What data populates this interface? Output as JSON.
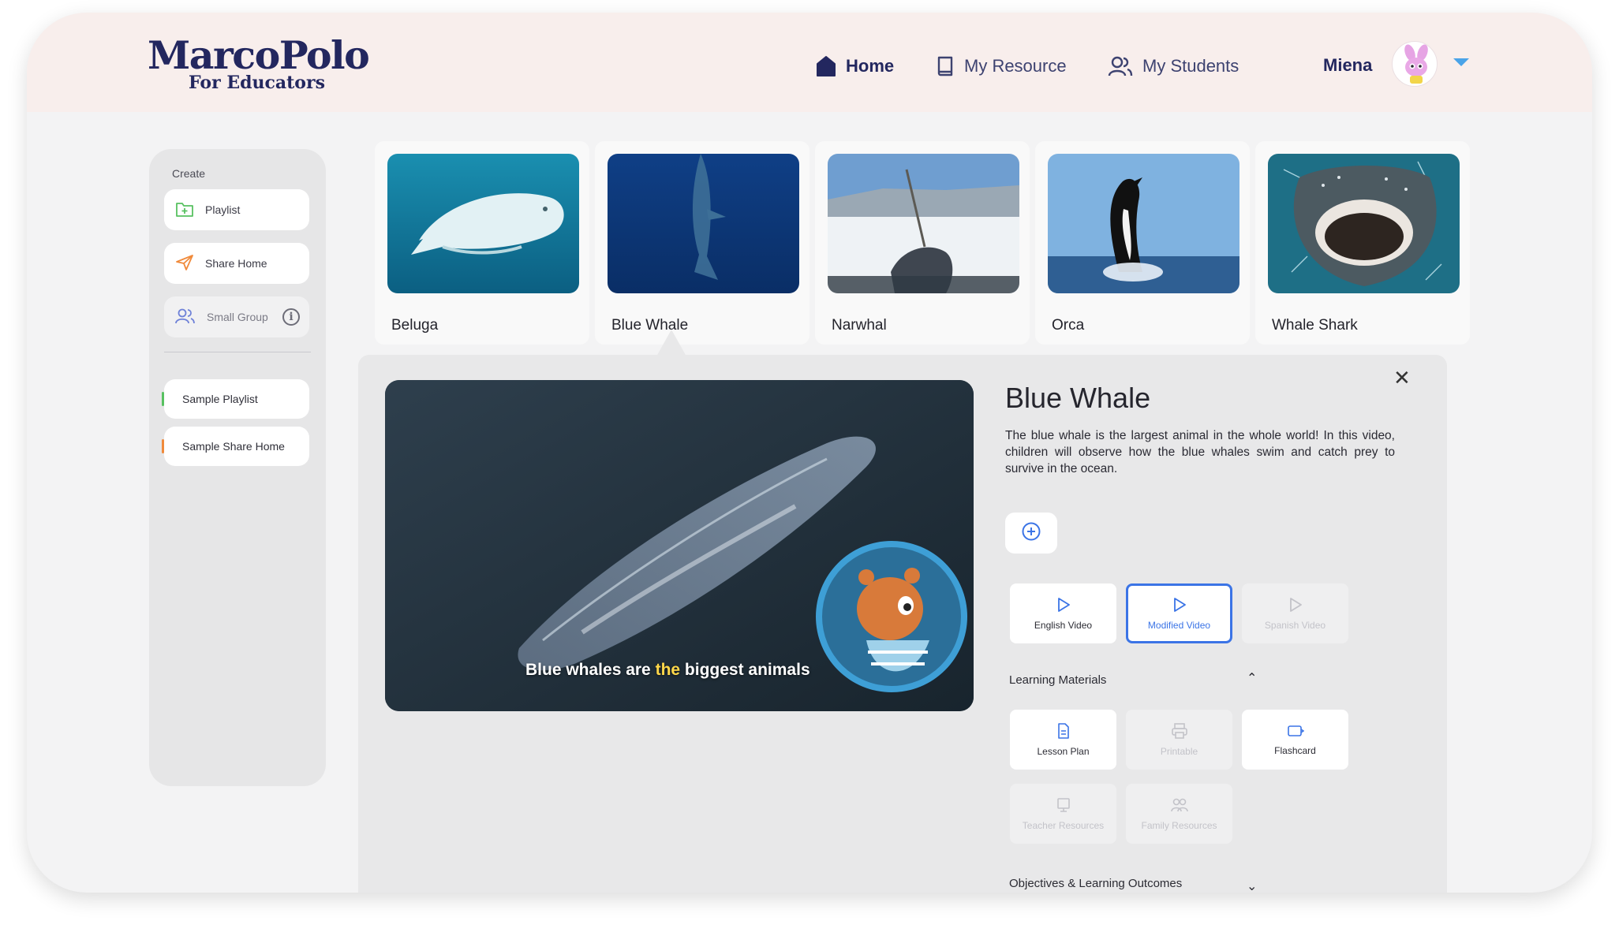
{
  "header": {
    "logo_main": "MarcoPolo",
    "logo_sub": "For Educators",
    "nav": [
      {
        "label": "Home",
        "icon": "home-icon",
        "active": true
      },
      {
        "label": "My Resource",
        "icon": "book-icon",
        "active": false
      },
      {
        "label": "My Students",
        "icon": "students-icon",
        "active": false
      }
    ],
    "user_name": "Miena"
  },
  "sidebar": {
    "create_label": "Create",
    "create_items": [
      {
        "label": "Playlist",
        "icon": "playlist-folder-icon"
      },
      {
        "label": "Share Home",
        "icon": "send-icon"
      },
      {
        "label": "Small Group",
        "icon": "group-icon",
        "info": "i"
      }
    ],
    "playlists": [
      {
        "label": "Sample Playlist",
        "accent": "#57c160"
      },
      {
        "label": "Sample Share Home",
        "accent": "#f08a3b"
      }
    ]
  },
  "cards": [
    {
      "name": "Beluga"
    },
    {
      "name": "Blue Whale"
    },
    {
      "name": "Narwhal"
    },
    {
      "name": "Orca"
    },
    {
      "name": "Whale Shark"
    }
  ],
  "detail": {
    "title": "Blue Whale",
    "description": "The blue whale is the largest animal in the whole world! In this video, children will observe how the blue whales swim and catch prey to survive in the ocean.",
    "caption_before": "Blue whales are ",
    "caption_highlight": "the",
    "caption_after": " biggest animals",
    "videos": [
      {
        "label": "English Video",
        "state": "normal"
      },
      {
        "label": "Modified Video",
        "state": "selected"
      },
      {
        "label": "Spanish Video",
        "state": "disabled"
      }
    ],
    "learning_materials_label": "Learning Materials",
    "materials": [
      {
        "label": "Lesson Plan",
        "state": "normal"
      },
      {
        "label": "Printable",
        "state": "disabled"
      },
      {
        "label": "Flashcard",
        "state": "normal"
      },
      {
        "label": "Teacher Resources",
        "state": "disabled"
      },
      {
        "label": "Family Resources",
        "state": "disabled"
      }
    ],
    "objectives_label": "Objectives & Learning Outcomes",
    "close_symbol": "✕",
    "caret_up": "⌃",
    "caret_down": "⌄"
  },
  "colors": {
    "brand_navy": "#23275f",
    "accent_blue": "#3b74e6",
    "header_bg": "#f8eeec"
  }
}
